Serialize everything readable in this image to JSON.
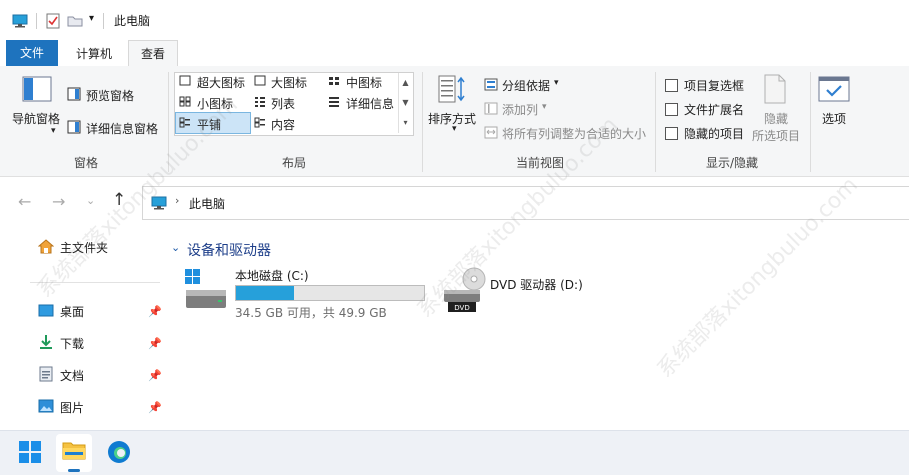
{
  "title_bar": {
    "title": "此电脑"
  },
  "tabs": [
    "文件",
    "计算机",
    "查看"
  ],
  "ribbon": {
    "panes": {
      "nav_pane": "导航窗格",
      "preview_pane": "预览窗格",
      "details_pane": "详细信息窗格",
      "group_label": "窗格"
    },
    "layout": {
      "options": [
        "超大图标",
        "大图标",
        "中图标",
        "小图标",
        "列表",
        "详细信息",
        "平铺",
        "内容"
      ],
      "selected": "平铺",
      "group_label": "布局"
    },
    "current_view": {
      "sort_by": "排序方式",
      "group_by": "分组依据",
      "add_column": "添加列",
      "fit_columns": "将所有列调整为合适的大小",
      "group_label": "当前视图"
    },
    "show_hide": {
      "item_checkboxes": "项目复选框",
      "file_extensions": "文件扩展名",
      "hidden_items": "隐藏的项目",
      "hide_selected_1": "隐藏",
      "hide_selected_2": "所选项目",
      "group_label": "显示/隐藏"
    },
    "options_label": "选项"
  },
  "address": {
    "location": "此电脑"
  },
  "sidebar": {
    "home": "主文件夹",
    "items": [
      "桌面",
      "下载",
      "文档",
      "图片"
    ]
  },
  "main": {
    "section_title": "设备和驱动器",
    "drives": [
      {
        "name": "本地磁盘 (C:)",
        "usage": "34.5 GB 可用，共 49.9 GB",
        "used_fraction": 0.31
      },
      {
        "name": "DVD 驱动器 (D:)",
        "badge": "DVD"
      }
    ]
  },
  "colors": {
    "accent": "#1e73be",
    "progress": "#26a0da"
  },
  "watermark": "系统部落xitongbuluo.com"
}
